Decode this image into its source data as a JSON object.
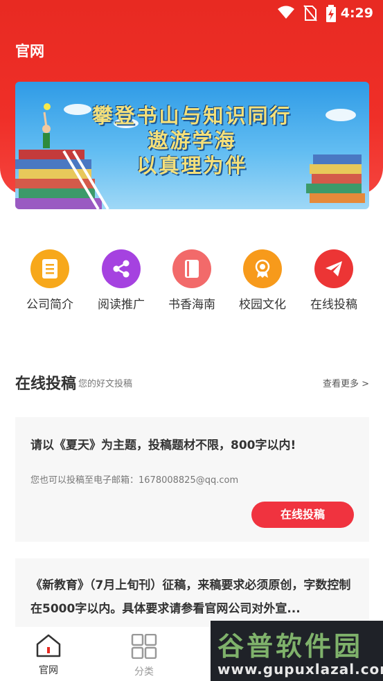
{
  "status_bar": {
    "time": "4:29"
  },
  "header": {
    "title": "官网"
  },
  "banner": {
    "lines": [
      "攀登书山与知识同行",
      "遨游学海",
      "以真理为伴"
    ]
  },
  "quick_links": [
    {
      "label": "公司简介",
      "icon": "doc-icon",
      "color": "#f7a81b"
    },
    {
      "label": "阅读推广",
      "icon": "share-icon",
      "color": "#a542e0"
    },
    {
      "label": "书香海南",
      "icon": "book-icon",
      "color": "#f26a6a"
    },
    {
      "label": "校园文化",
      "icon": "badge-icon",
      "color": "#f79a1b"
    },
    {
      "label": "在线投稿",
      "icon": "send-icon",
      "color": "#ec3535"
    }
  ],
  "section": {
    "title": "在线投稿",
    "subtitle": "您的好文投稿",
    "more": "查看更多 >"
  },
  "cards": [
    {
      "title": "请以《夏天》为主题，投稿题材不限，800字以内!",
      "subtitle": "您也可以投稿至电子邮箱：1678008825@qq.com",
      "button": "在线投稿"
    },
    {
      "title": "《新教育》（7月上旬刊）征稿，来稿要求必须原创，字数控制在5000字以内。具体要求请参看官网公司对外宣..."
    }
  ],
  "tabs": [
    {
      "label": "官网",
      "active": true,
      "color": "#333333"
    },
    {
      "label": "分类",
      "active": false,
      "color": "#999999"
    }
  ],
  "watermark": {
    "brand": "谷普软件园",
    "url": "www.gupuxlazal.com"
  }
}
